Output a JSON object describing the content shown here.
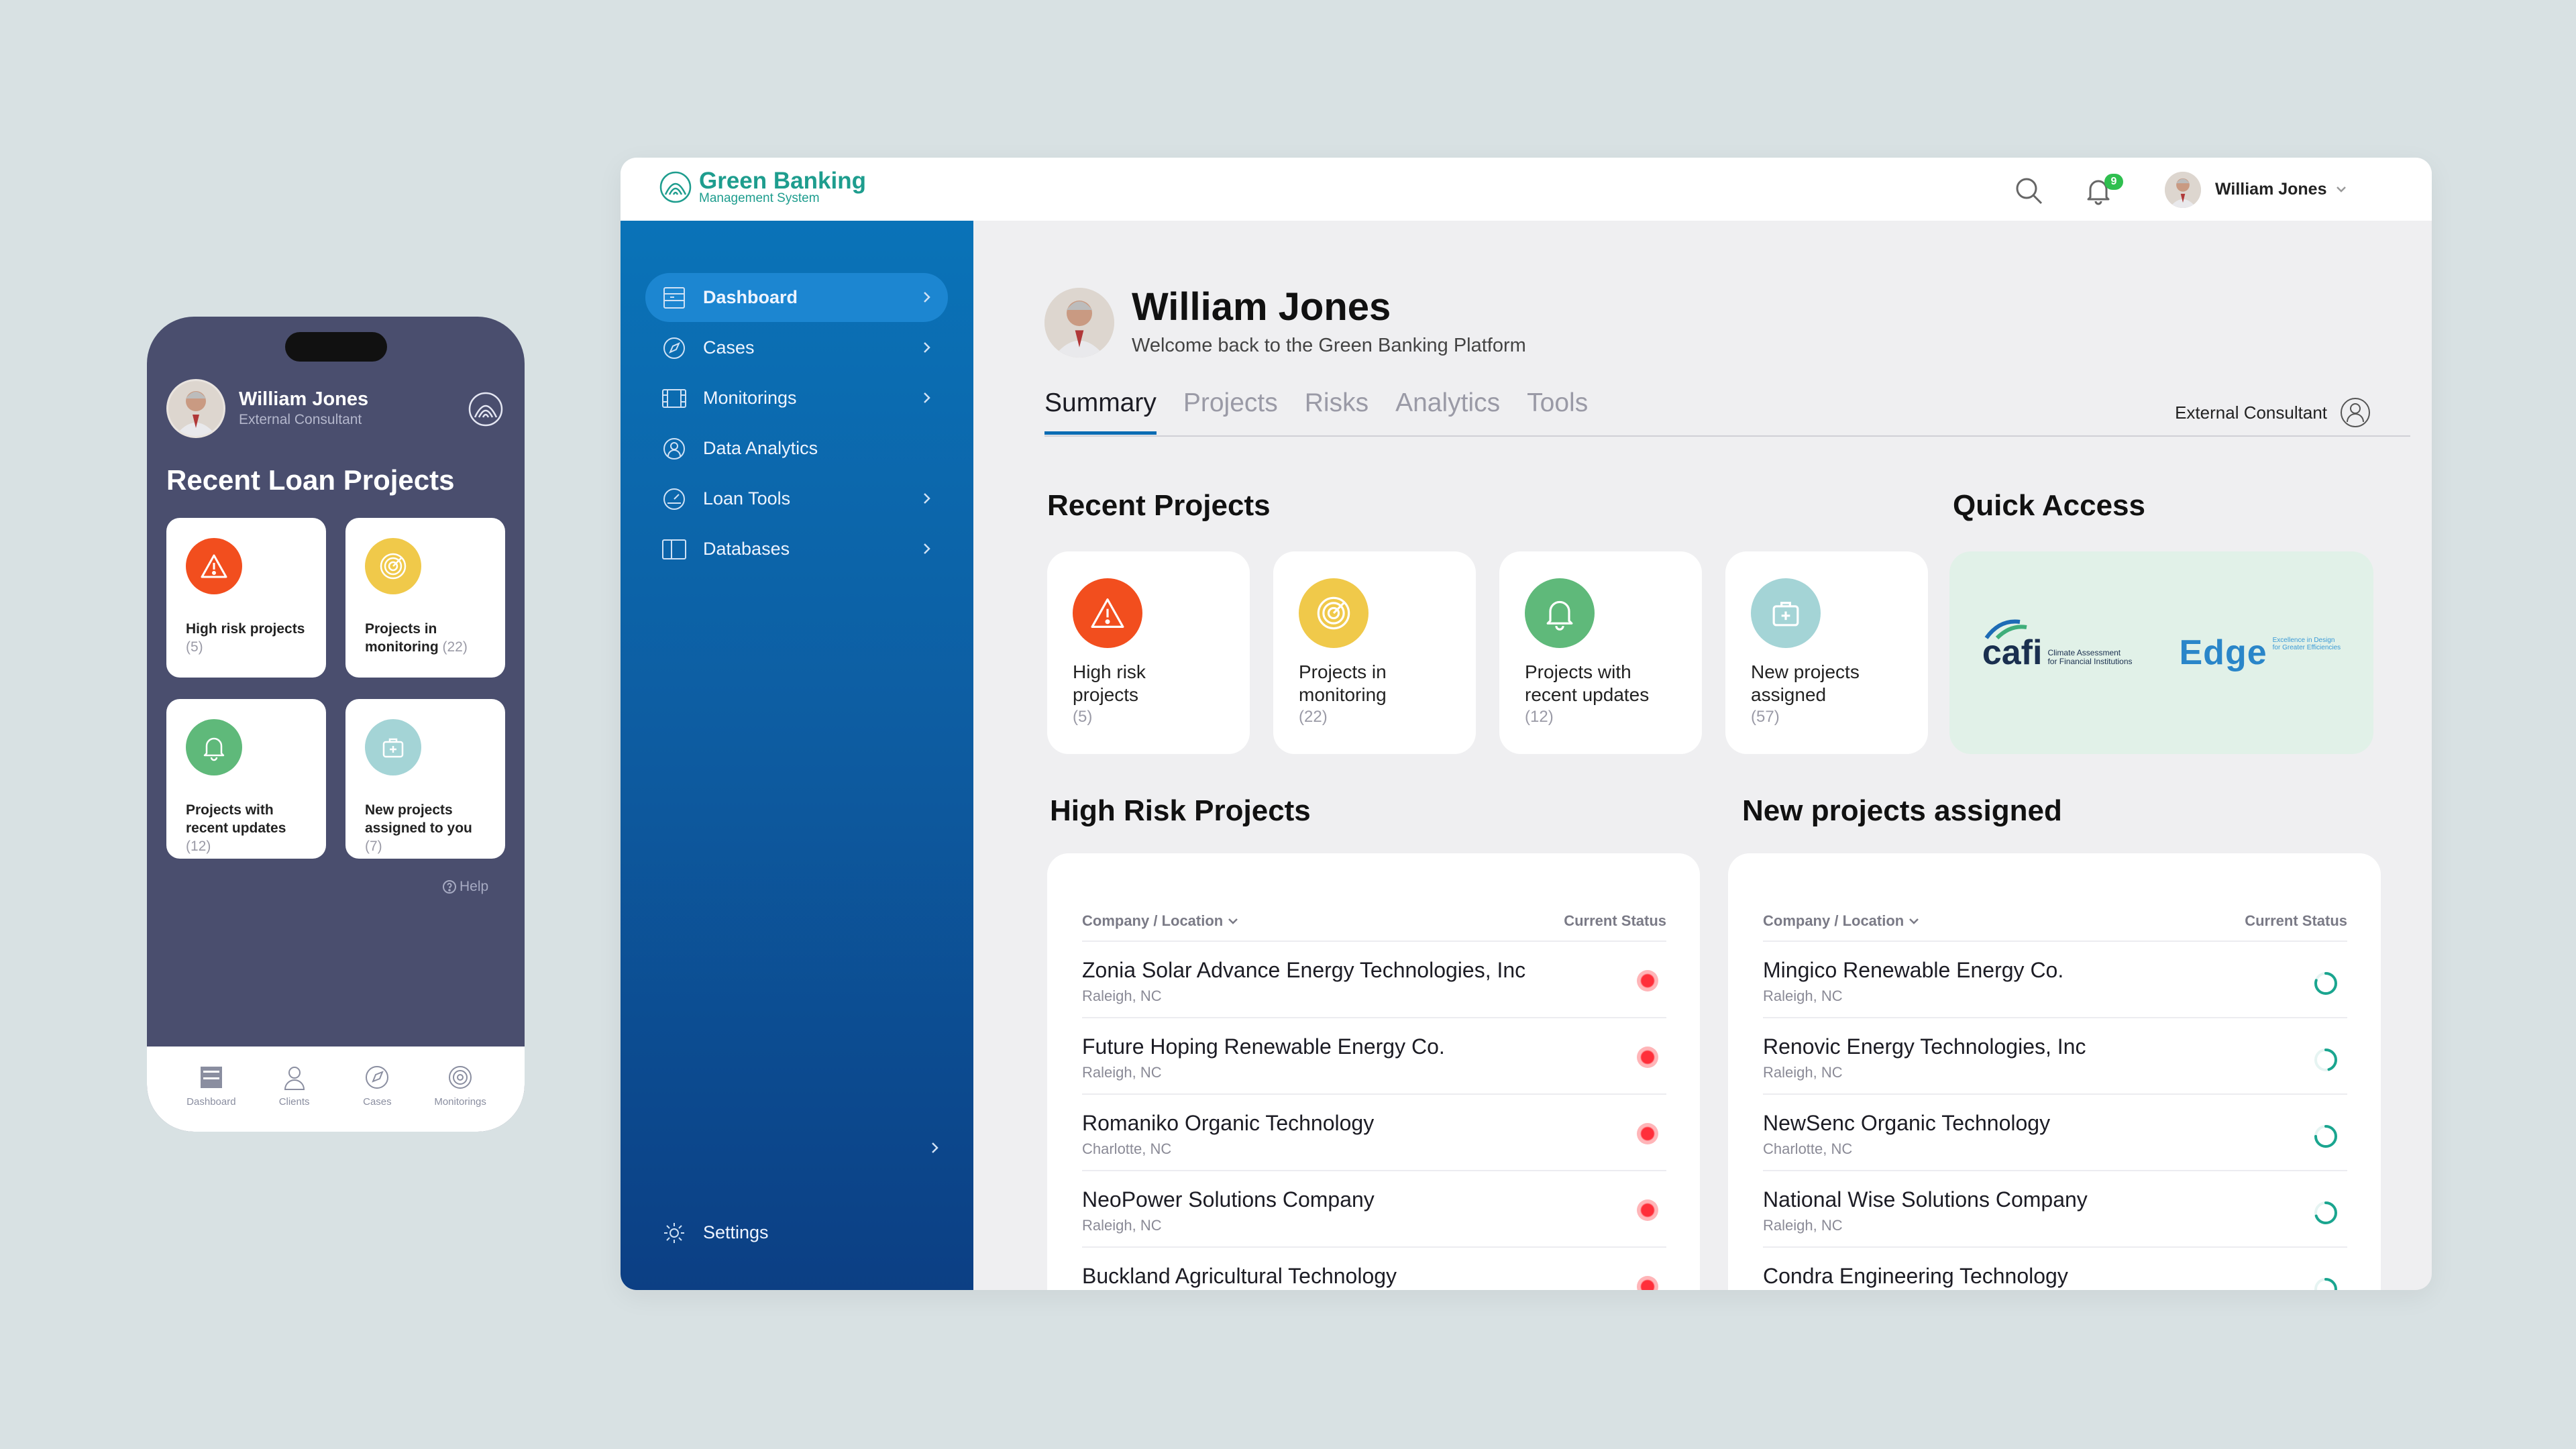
{
  "phone": {
    "user_name": "William Jones",
    "user_role": "External Consultant",
    "title": "Recent Loan Projects",
    "cards": [
      {
        "label": "High risk projects",
        "count": "(5)",
        "icon": "warning-icon",
        "color": "#f24e1e"
      },
      {
        "label": "Projects in monitoring",
        "count": "(22)",
        "icon": "radar-icon",
        "color": "#f0c94a"
      },
      {
        "label": "Projects with recent updates",
        "count": "(12)",
        "icon": "bell-icon",
        "color": "#5fb97a"
      },
      {
        "label": "New projects assigned to you",
        "count": "(7)",
        "icon": "briefcase-icon",
        "color": "#a4d4d6"
      }
    ],
    "help": "Help",
    "nav": [
      {
        "label": "Dashboard",
        "icon": "dashboard-icon"
      },
      {
        "label": "Clients",
        "icon": "clients-icon"
      },
      {
        "label": "Cases",
        "icon": "compass-icon"
      },
      {
        "label": "Monitorings",
        "icon": "radar-icon"
      }
    ]
  },
  "topbar": {
    "brand_title": "Green Banking",
    "brand_sub": "Management System",
    "notification_count": "9",
    "user_name": "William Jones"
  },
  "sidebar": {
    "items": [
      {
        "label": "Dashboard",
        "icon": "dashboard-icon"
      },
      {
        "label": "Cases",
        "icon": "compass-icon"
      },
      {
        "label": "Monitorings",
        "icon": "film-icon"
      },
      {
        "label": "Data Analytics",
        "icon": "person-circle-icon"
      },
      {
        "label": "Loan Tools",
        "icon": "gauge-icon"
      },
      {
        "label": "Databases",
        "icon": "book-icon"
      }
    ],
    "settings": "Settings"
  },
  "main": {
    "name": "William Jones",
    "welcome": "Welcome back to the Green Banking Platform",
    "tabs": [
      "Summary",
      "Projects",
      "Risks",
      "Analytics",
      "Tools"
    ],
    "role": "External Consultant",
    "recent_title": "Recent Projects",
    "quick_title": "Quick Access",
    "recent_cards": [
      {
        "line1": "High risk",
        "line2": "projects",
        "count": "(5)",
        "color": "#f24e1e"
      },
      {
        "line1": "Projects in",
        "line2": "monitoring",
        "count": "(22)",
        "color": "#f0c94a"
      },
      {
        "line1": "Projects with",
        "line2": "recent updates",
        "count": "(12)",
        "color": "#5fb97a"
      },
      {
        "line1": "New projects",
        "line2": "assigned",
        "count": "(57)",
        "color": "#a4d4d6"
      }
    ],
    "quick_logos": {
      "cafi": "cafi",
      "cafi_sub1": "Climate Assessment",
      "cafi_sub2": "for Financial Institutions",
      "edge": "Edge",
      "edge_sub1": "Excellence in Design",
      "edge_sub2": "for Greater Efficiencies"
    },
    "high_risk_title": "High Risk Projects",
    "new_assigned_title": "New projects assigned",
    "col_company": "Company / Location",
    "col_status": "Current Status",
    "high_risk_rows": [
      {
        "name": "Zonia Solar Advance Energy Technologies, Inc",
        "loc": "Raleigh, NC"
      },
      {
        "name": "Future Hoping Renewable Energy Co.",
        "loc": "Raleigh, NC"
      },
      {
        "name": "Romaniko Organic Technology",
        "loc": "Charlotte, NC"
      },
      {
        "name": "NeoPower Solutions Company",
        "loc": "Raleigh, NC"
      },
      {
        "name": "Buckland Agricultural Technology",
        "loc": ""
      }
    ],
    "new_rows": [
      {
        "name": "Mingico Renewable Energy Co.",
        "loc": "Raleigh, NC",
        "progress": 0.8
      },
      {
        "name": "Renovic Energy Technologies, Inc",
        "loc": "Raleigh, NC",
        "progress": 0.45
      },
      {
        "name": "NewSenc Organic Technology",
        "loc": "Charlotte, NC",
        "progress": 0.75
      },
      {
        "name": "National Wise Solutions Company",
        "loc": "Raleigh, NC",
        "progress": 0.7
      },
      {
        "name": "Condra Engineering Technology",
        "loc": "",
        "progress": 0.5
      }
    ]
  }
}
